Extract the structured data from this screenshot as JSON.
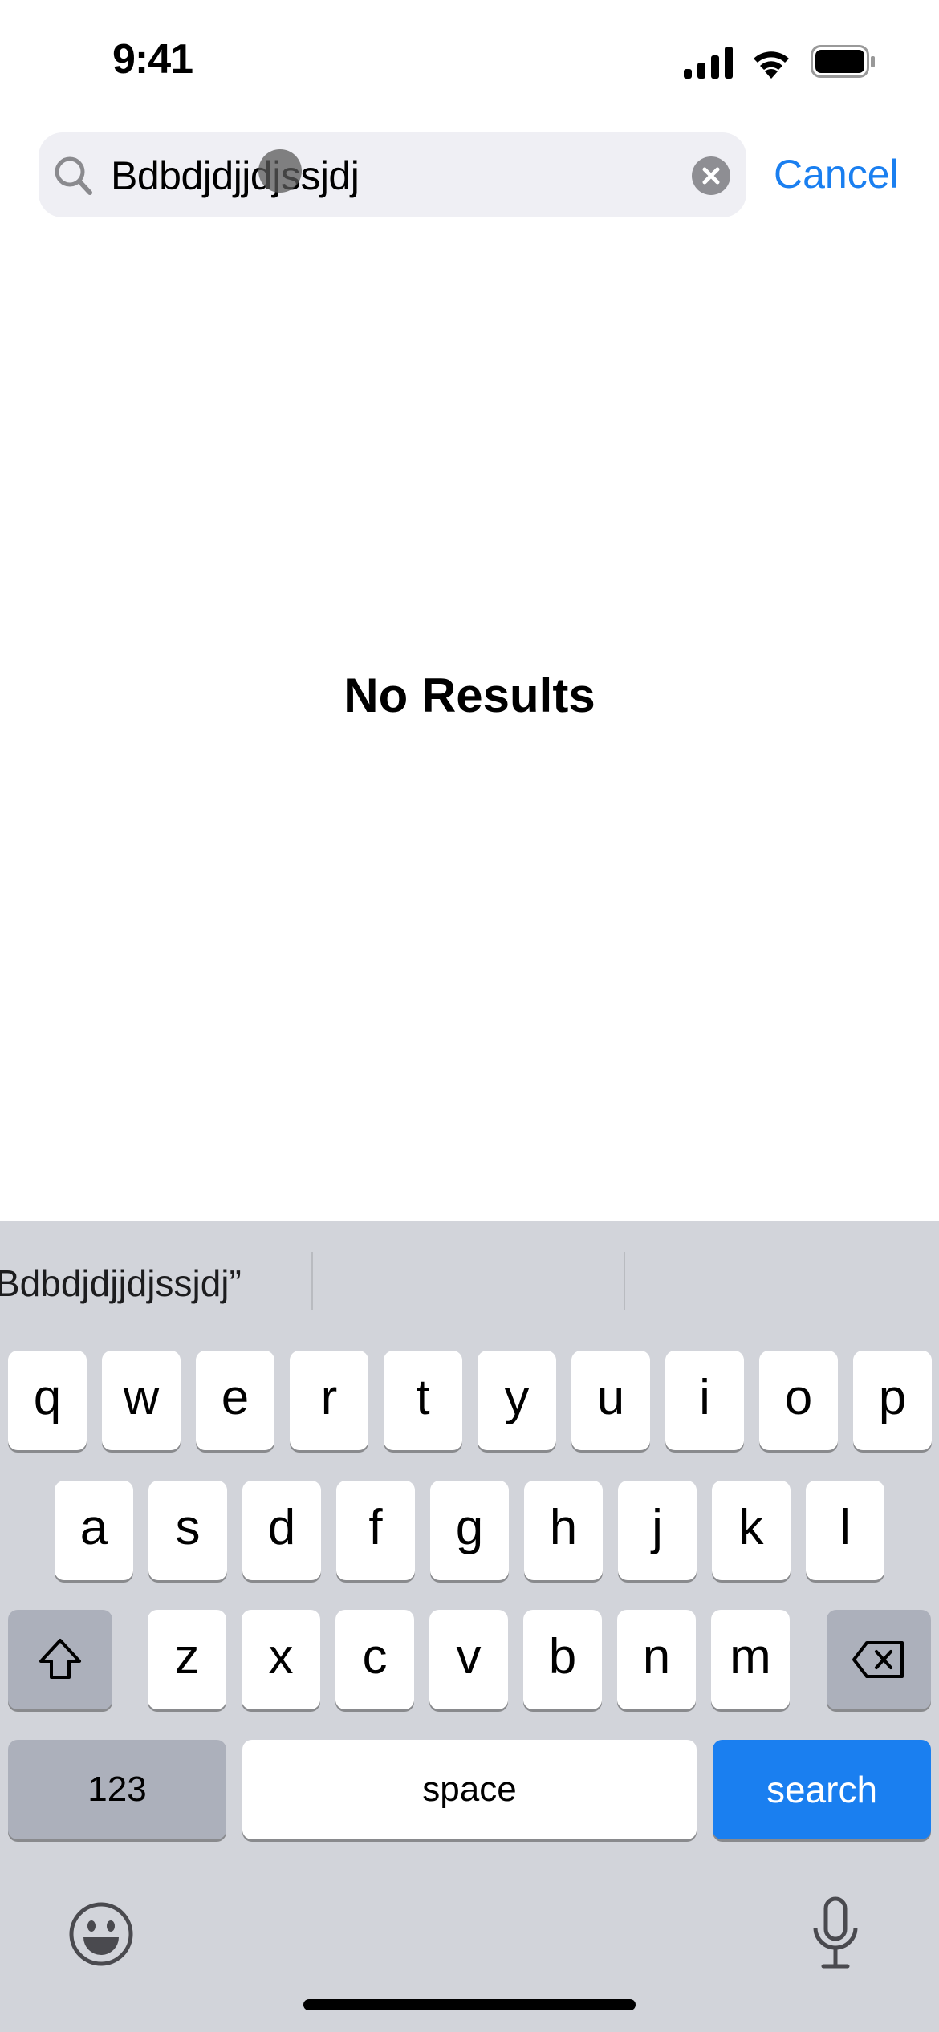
{
  "status_bar": {
    "time": "9:41",
    "icons": [
      "cellular-signal-icon",
      "wifi-icon",
      "battery-icon"
    ]
  },
  "search": {
    "value": "Bdbdjdjjdjssjdj",
    "cancel_label": "Cancel",
    "icon": "magnifying-glass-icon"
  },
  "main": {
    "empty_state": "No Results"
  },
  "keyboard": {
    "suggestions": [
      "Bdbdjdjjdjssjdj”",
      "",
      ""
    ],
    "row1": [
      "q",
      "w",
      "e",
      "r",
      "t",
      "y",
      "u",
      "i",
      "o",
      "p"
    ],
    "row2": [
      "a",
      "s",
      "d",
      "f",
      "g",
      "h",
      "j",
      "k",
      "l"
    ],
    "row3": [
      "z",
      "x",
      "c",
      "v",
      "b",
      "n",
      "m"
    ],
    "numbers_label": "123",
    "space_label": "space",
    "search_label": "search"
  },
  "colors": {
    "accent": "#1a7ff0",
    "keyboard_bg": "#d2d4da",
    "search_bg": "#efeff4"
  }
}
